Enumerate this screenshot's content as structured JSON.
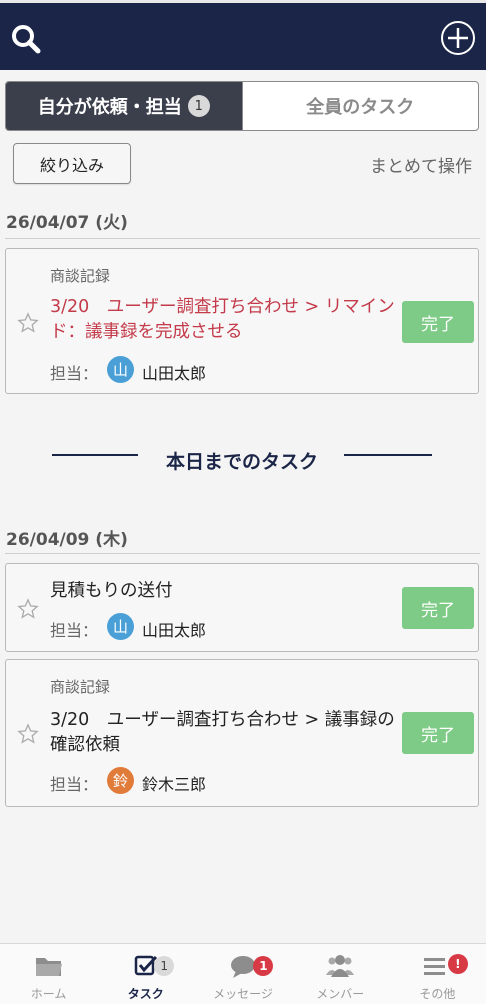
{
  "header": {
    "search_icon": "search-icon",
    "add_icon": "plus-circle-icon",
    "bg_color": "#1b2547"
  },
  "tabs": {
    "mine_label": "自分が依頼・担当",
    "mine_count": "1",
    "all_label": "全員のタスク"
  },
  "toolbar": {
    "filter_label": "絞り込み",
    "bulk_label": "まとめて操作"
  },
  "groups": [
    {
      "date": "26/04/07 (火)",
      "tasks": [
        {
          "category": "商談記録",
          "title": "3/20　ユーザー調査打ち合わせ > リマインド：議事録を完成させる",
          "assignee_label": "担当：",
          "assignee_initial": "山",
          "assignee_name": "山田太郎",
          "assignee_color": "#4aa0d6",
          "done_label": "完了",
          "overdue": true
        }
      ]
    },
    {
      "date": "26/04/09 (木)",
      "tasks": [
        {
          "category": "",
          "title": "見積もりの送付",
          "assignee_label": "担当：",
          "assignee_initial": "山",
          "assignee_name": "山田太郎",
          "assignee_color": "#4aa0d6",
          "done_label": "完了",
          "overdue": false
        },
        {
          "category": "商談記録",
          "title": "3/20　ユーザー調査打ち合わせ > 議事録の確認依頼",
          "assignee_label": "担当：",
          "assignee_initial": "鈴",
          "assignee_name": "鈴木三郎",
          "assignee_color": "#e07b3a",
          "done_label": "完了",
          "overdue": false
        }
      ]
    }
  ],
  "section": {
    "label": "本日までのタスク"
  },
  "nav": [
    {
      "label": "ホーム",
      "icon": "folder-icon",
      "badge": ""
    },
    {
      "label": "タスク",
      "icon": "checkbox-icon",
      "badge": "1"
    },
    {
      "label": "メッセージ",
      "icon": "chat-bubble-icon",
      "badge": "1"
    },
    {
      "label": "メンバー",
      "icon": "members-icon",
      "badge": ""
    },
    {
      "label": "その他",
      "icon": "menu-icon",
      "badge": "!"
    }
  ],
  "colors": {
    "accent": "#1b2547",
    "done": "#7dcb86",
    "overdue": "#c33a4a",
    "badge_red": "#d83a45"
  }
}
